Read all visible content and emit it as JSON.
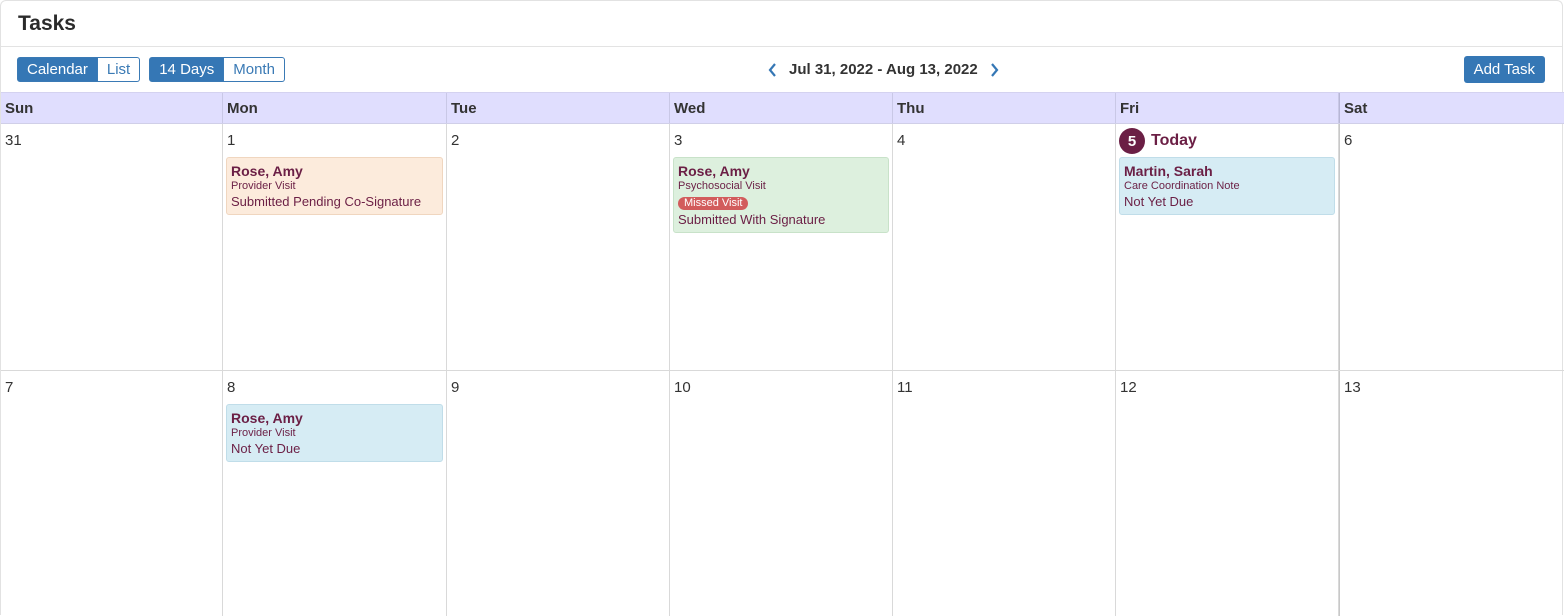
{
  "page": {
    "title": "Tasks"
  },
  "toolbar": {
    "view_calendar": "Calendar",
    "view_list": "List",
    "range_14days": "14 Days",
    "range_month": "Month",
    "date_range": "Jul 31, 2022 - Aug 13, 2022",
    "add_task": "Add Task",
    "prev_icon": "chevron-left-icon",
    "next_icon": "chevron-right-icon"
  },
  "colors": {
    "accent": "#3577b5",
    "today": "#6b1f45",
    "header_bg": "#e0defe",
    "event_orange": "#fcebdc",
    "event_green": "#ddf0de",
    "event_blue": "#d6ecf4",
    "missed_badge": "#d25c5c"
  },
  "calendar": {
    "weekdays": [
      "Sun",
      "Mon",
      "Tue",
      "Wed",
      "Thu",
      "Fri",
      "Sat"
    ],
    "today_label": "Today",
    "weeks": [
      [
        "31",
        "1",
        "2",
        "3",
        "4",
        "5",
        "6"
      ],
      [
        "7",
        "8",
        "9",
        "10",
        "11",
        "12",
        "13"
      ]
    ],
    "events": {
      "aug1": {
        "name": "Rose, Amy",
        "type": "Provider Visit",
        "status": "Submitted Pending Co-Signature"
      },
      "aug3": {
        "name": "Rose, Amy",
        "type": "Psychosocial Visit",
        "badge": "Missed Visit",
        "status": "Submitted With Signature"
      },
      "aug5": {
        "name": "Martin, Sarah",
        "type": "Care Coordination Note",
        "status": "Not Yet Due"
      },
      "aug8": {
        "name": "Rose, Amy",
        "type": "Provider Visit",
        "status": "Not Yet Due"
      }
    }
  }
}
